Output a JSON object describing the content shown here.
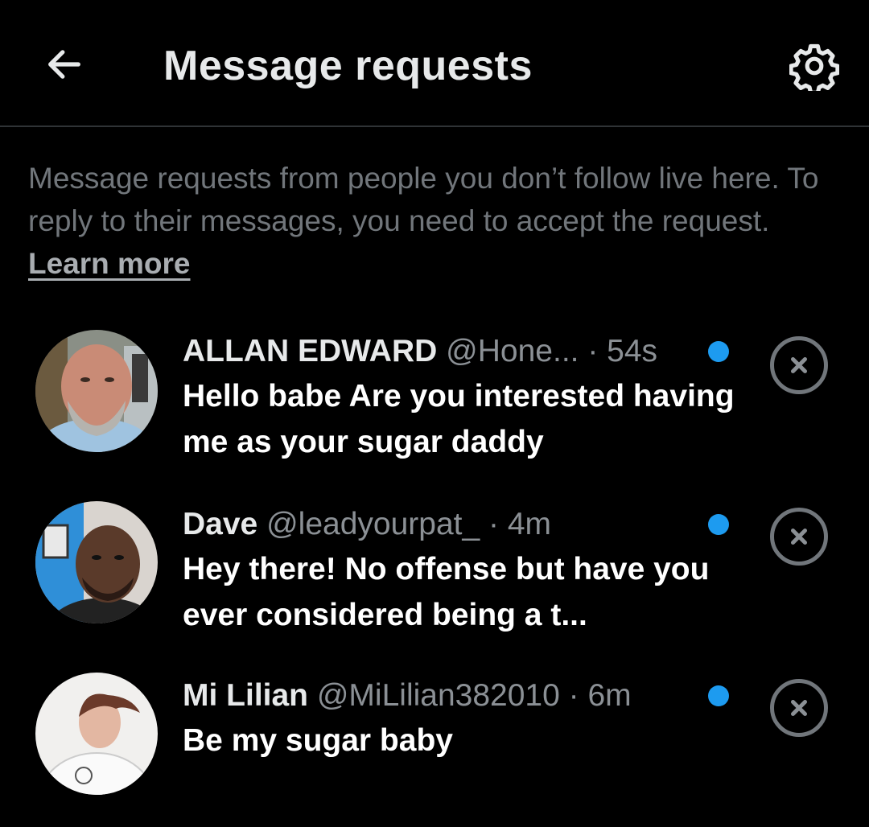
{
  "header": {
    "title": "Message requests",
    "back_icon": "arrow-left-icon",
    "settings_icon": "gear-icon"
  },
  "notice": {
    "text": "Message requests from people you don’t follow live here. To reply to their messages, you need to accept the request.",
    "link_label": "Learn more"
  },
  "requests": [
    {
      "name": "ALLAN EDWARD",
      "handle": "@Hone...",
      "time": "· 54s",
      "message": "Hello babe  Are you interested having me as your sugar daddy",
      "unread": true
    },
    {
      "name": "Dave",
      "handle": "@leadyourpat_",
      "time": "· 4m",
      "message": "Hey there! No offense but have you ever considered being a t...",
      "unread": true
    },
    {
      "name": "Mi Lilian",
      "handle": "@MiLilian382010",
      "time": "· 6m",
      "message": "Be my sugar baby",
      "unread": true
    }
  ],
  "colors": {
    "background": "#000000",
    "accent_dot": "#1d9bf0",
    "muted_text": "#71767b"
  }
}
